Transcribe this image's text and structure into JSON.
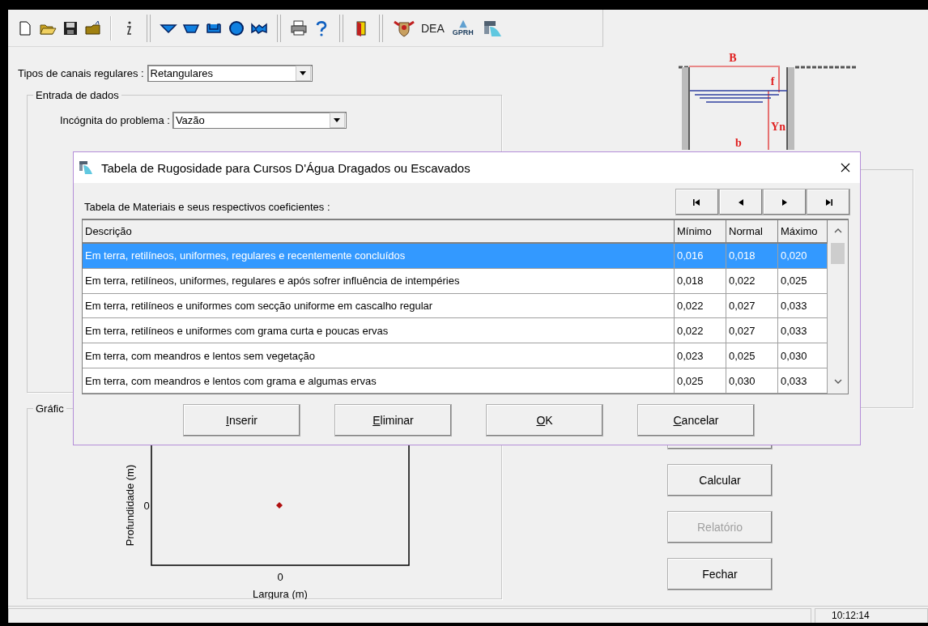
{
  "toolbar": {
    "dea_label": "DEA",
    "gprh_label": "GPRH"
  },
  "channel_type": {
    "label": "Tipos de canais regulares :",
    "value": "Retangulares"
  },
  "input_group": {
    "title": "Entrada de dados",
    "unknown_label": "Incógnita do problema :",
    "unknown_value": "Vazão"
  },
  "diagram": {
    "top_width": "B",
    "freeboard": "f",
    "depth": "Yn",
    "bottom_width": "b"
  },
  "chart_group": {
    "title": "Gráfic",
    "ylabel": "Profundidade (m)",
    "xlabel": "Largura (m)",
    "y_tick": "0",
    "x_tick": "0"
  },
  "actions": [
    {
      "label": "Calcular",
      "disabled": false
    },
    {
      "label": "Relatório",
      "disabled": true
    },
    {
      "label": "Fechar",
      "disabled": false
    }
  ],
  "status_bar": {
    "time": "10:12:14"
  },
  "dialog": {
    "title": "Tabela de Rugosidade para Cursos D'Água Dragados ou Escavados",
    "table_label": "Tabela de Materiais e seus respectivos coeficientes :",
    "columns": [
      "Descrição",
      "Mínimo",
      "Normal",
      "Máximo"
    ],
    "rows": [
      {
        "description": "Em terra, retilíneos, uniformes, regulares e recentemente concluídos",
        "min": "0,016",
        "normal": "0,018",
        "max": "0,020",
        "selected": true
      },
      {
        "description": "Em terra, retilíneos, uniformes, regulares e após sofrer influência de intempéries",
        "min": "0,018",
        "normal": "0,022",
        "max": "0,025",
        "selected": false
      },
      {
        "description": "Em terra, retilíneos e uniformes com secção uniforme em cascalho regular",
        "min": "0,022",
        "normal": "0,027",
        "max": "0,033",
        "selected": false
      },
      {
        "description": "Em terra, retilíneos e uniformes com grama curta e poucas ervas",
        "min": "0,022",
        "normal": "0,027",
        "max": "0,033",
        "selected": false
      },
      {
        "description": "Em terra, com meandros e lentos sem vegetação",
        "min": "0,023",
        "normal": "0,025",
        "max": "0,030",
        "selected": false
      },
      {
        "description": "Em terra, com meandros e lentos com grama e algumas ervas",
        "min": "0,025",
        "normal": "0,030",
        "max": "0,033",
        "selected": false
      }
    ],
    "buttons": [
      {
        "accel": "I",
        "rest": "nserir"
      },
      {
        "accel": "E",
        "rest": "liminar"
      },
      {
        "accel": "O",
        "rest": "K"
      },
      {
        "accel": "C",
        "rest": "ancelar"
      }
    ]
  }
}
